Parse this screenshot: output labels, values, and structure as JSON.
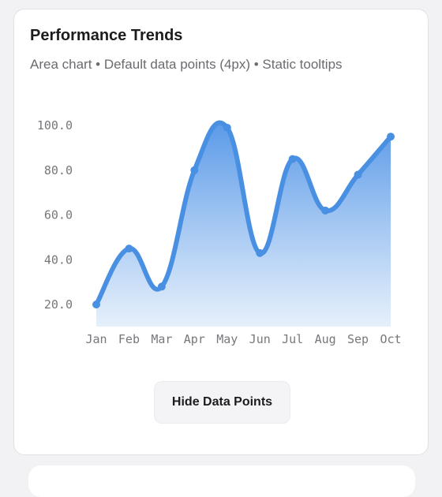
{
  "card": {
    "title": "Performance Trends",
    "subtitle": "Area chart • Default data points (4px) • Static tooltips",
    "toggle_label": "Hide Data Points"
  },
  "colors": {
    "line": "#4a90e2",
    "area_top": "#5a9ae8",
    "area_bottom": "#e3eefb"
  },
  "chart_data": {
    "type": "area",
    "categories": [
      "Jan",
      "Feb",
      "Mar",
      "Apr",
      "May",
      "Jun",
      "Jul",
      "Aug",
      "Sep",
      "Oct"
    ],
    "values": [
      20,
      45,
      28,
      80,
      99,
      43,
      85,
      62,
      78,
      95
    ],
    "yticks": [
      "100.0",
      "80.0",
      "60.0",
      "40.0",
      "20.0"
    ],
    "ytick_values": [
      100,
      80,
      60,
      40,
      20
    ],
    "ylim": [
      10,
      110
    ],
    "grid": false,
    "legend": "none"
  }
}
